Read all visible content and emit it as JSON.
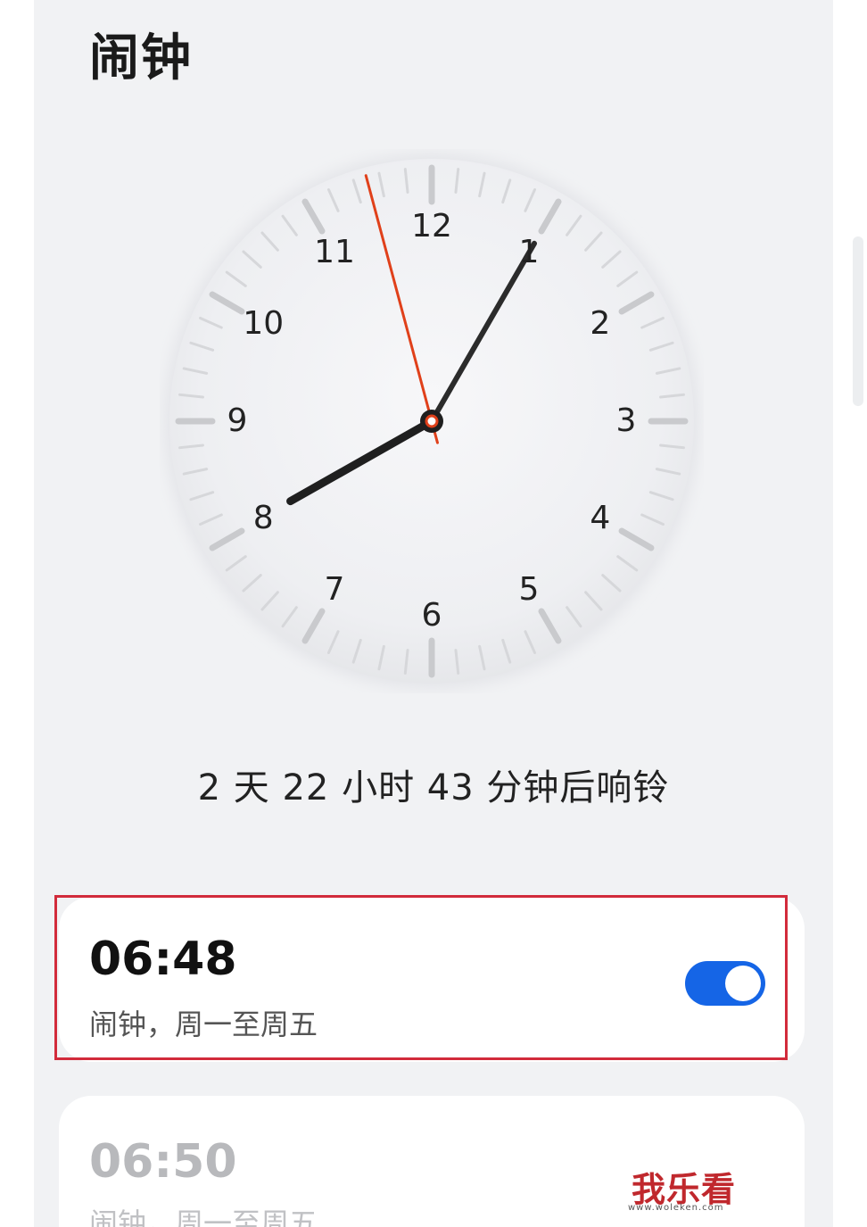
{
  "header": {
    "title": "闹钟"
  },
  "clock": {
    "numerals": [
      "12",
      "1",
      "2",
      "3",
      "4",
      "5",
      "6",
      "7",
      "8",
      "9",
      "10",
      "11"
    ],
    "hand_colors": {
      "hour": "#1f1f1f",
      "minute": "#2b2b2b",
      "second": "#e0401a"
    }
  },
  "countdown": {
    "text": "2 天 22 小时 43 分钟后响铃"
  },
  "alarms": [
    {
      "time": "06:48",
      "subtitle": "闹钟，周一至周五",
      "enabled": true
    },
    {
      "time": "06:50",
      "subtitle": "闹钟，周一至周五",
      "enabled": false
    }
  ],
  "colors": {
    "accent": "#1565e6",
    "highlight": "#d22b3b"
  },
  "watermark": {
    "text": "我乐看",
    "url": "www.woleken.com"
  }
}
